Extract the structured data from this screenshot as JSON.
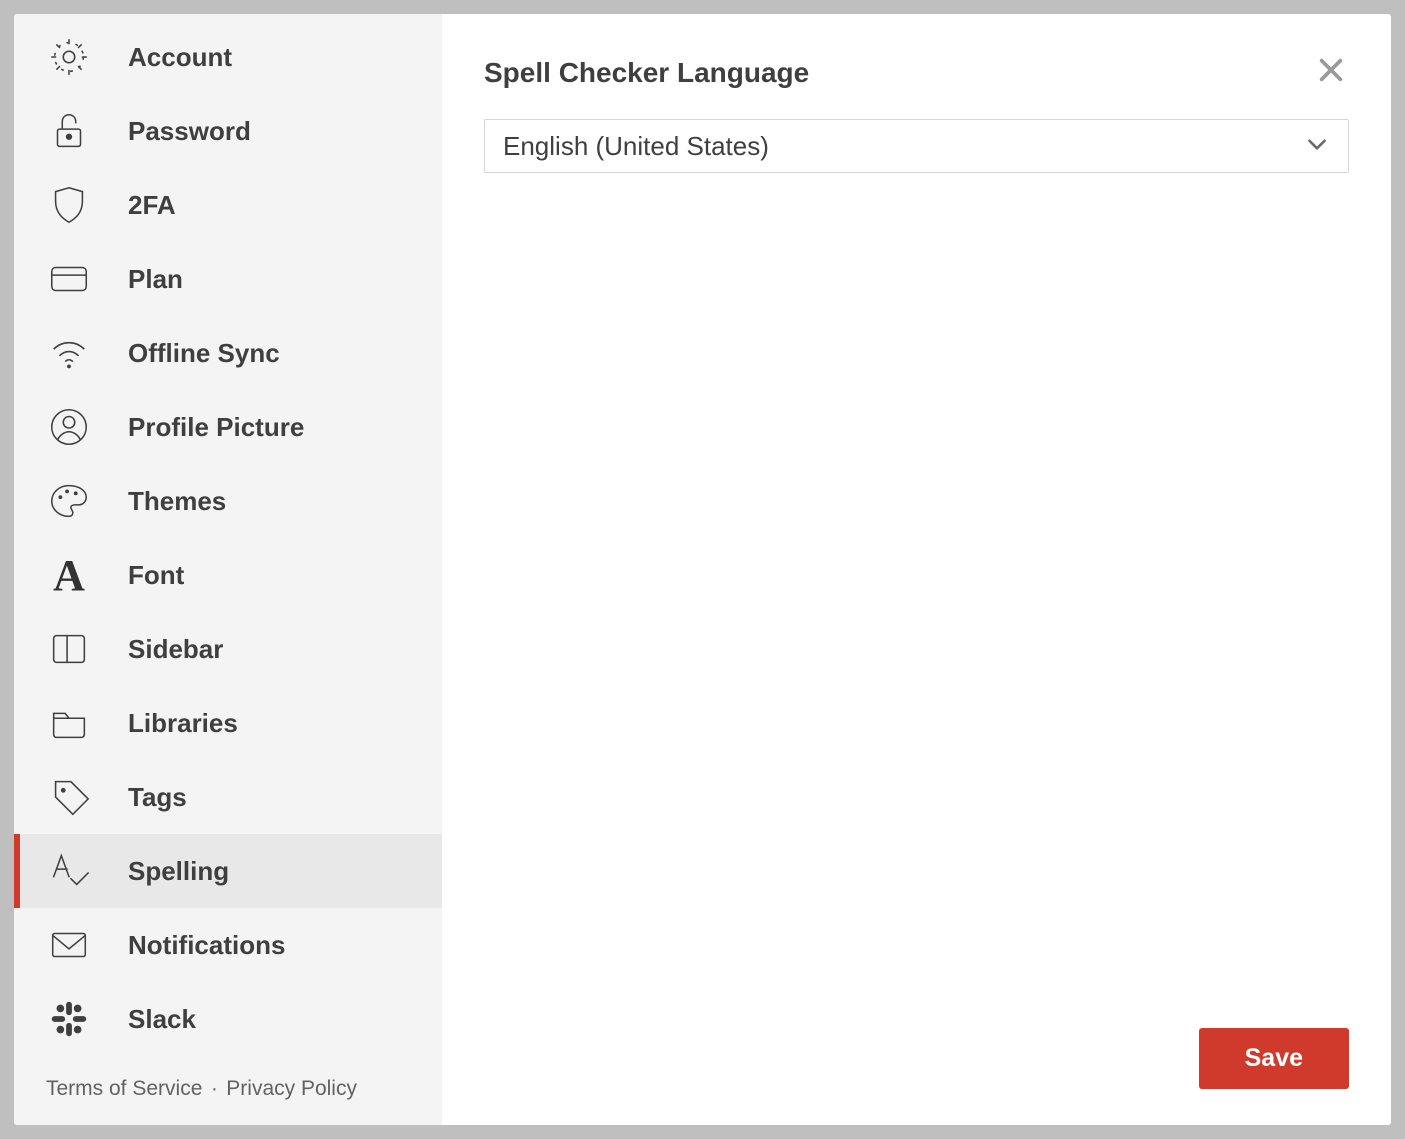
{
  "sidebar": {
    "items": [
      {
        "id": "account",
        "label": "Account",
        "icon": "gear-icon"
      },
      {
        "id": "password",
        "label": "Password",
        "icon": "lock-icon"
      },
      {
        "id": "2fa",
        "label": "2FA",
        "icon": "shield-icon"
      },
      {
        "id": "plan",
        "label": "Plan",
        "icon": "card-icon"
      },
      {
        "id": "offline-sync",
        "label": "Offline Sync",
        "icon": "wifi-icon"
      },
      {
        "id": "profile-picture",
        "label": "Profile Picture",
        "icon": "avatar-icon"
      },
      {
        "id": "themes",
        "label": "Themes",
        "icon": "palette-icon"
      },
      {
        "id": "font",
        "label": "Font",
        "icon": "font-icon"
      },
      {
        "id": "sidebar",
        "label": "Sidebar",
        "icon": "columns-icon"
      },
      {
        "id": "libraries",
        "label": "Libraries",
        "icon": "folder-icon"
      },
      {
        "id": "tags",
        "label": "Tags",
        "icon": "tag-icon"
      },
      {
        "id": "spelling",
        "label": "Spelling",
        "icon": "spellcheck-icon",
        "active": true
      },
      {
        "id": "notifications",
        "label": "Notifications",
        "icon": "mail-icon"
      },
      {
        "id": "slack",
        "label": "Slack",
        "icon": "slack-icon"
      }
    ]
  },
  "footer": {
    "terms_label": "Terms of Service",
    "separator": "·",
    "privacy_label": "Privacy Policy"
  },
  "panel": {
    "title": "Spell Checker Language",
    "select": {
      "value": "English (United States)"
    },
    "save_label": "Save"
  }
}
